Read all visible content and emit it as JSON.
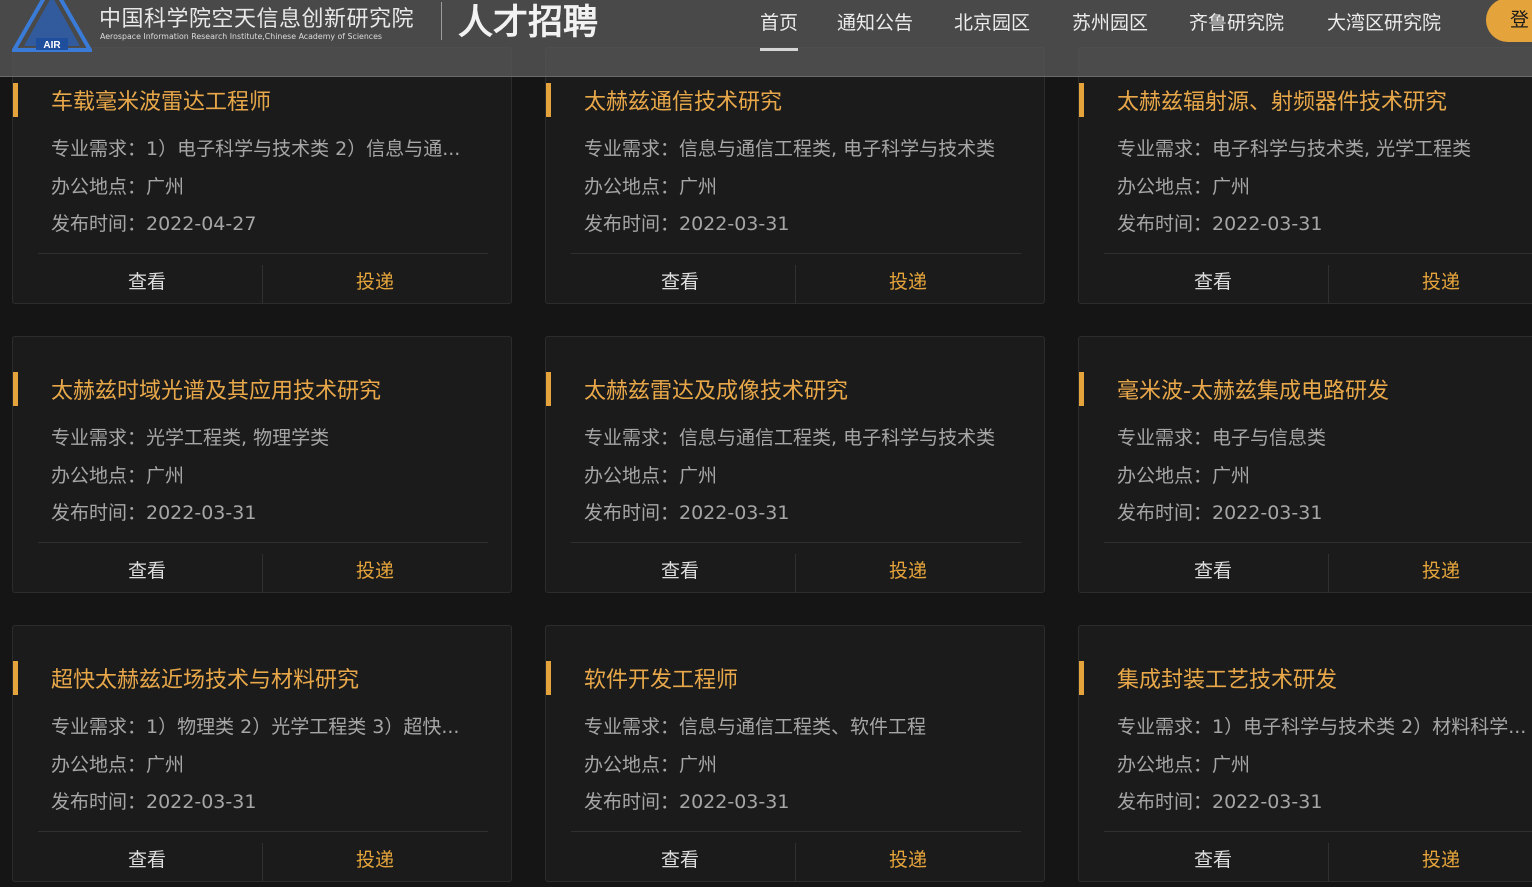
{
  "header": {
    "org_name_cn": "中国科学院空天信息创新研究院",
    "org_name_en": "Aerospace Information Research Institute,Chinese Academy of Sciences",
    "logo_text": "AIR",
    "recruit_title": "人才招聘",
    "nav": [
      "首页",
      "通知公告",
      "北京园区",
      "苏州园区",
      "齐鲁研究院",
      "大湾区研究院"
    ],
    "active_nav": "首页",
    "login_label": "登"
  },
  "colors": {
    "accent": "#e5a43b",
    "background": "#151515",
    "card": "#1b1b1b"
  },
  "card_buttons": {
    "view": "查看",
    "apply": "投递"
  },
  "jobs": [
    {
      "title": "车载毫米波雷达工程师",
      "major": "专业需求：1）电子科学与技术类 2）信息与通...",
      "location": "办公地点：广州",
      "date": "发布时间：2022-04-27"
    },
    {
      "title": "太赫兹通信技术研究",
      "major": "专业需求：信息与通信工程类, 电子科学与技术类",
      "location": "办公地点：广州",
      "date": "发布时间：2022-03-31"
    },
    {
      "title": "太赫兹辐射源、射频器件技术研究",
      "major": "专业需求：电子科学与技术类, 光学工程类",
      "location": "办公地点：广州",
      "date": "发布时间：2022-03-31"
    },
    {
      "title": "太赫兹时域光谱及其应用技术研究",
      "major": "专业需求：光学工程类, 物理学类",
      "location": "办公地点：广州",
      "date": "发布时间：2022-03-31"
    },
    {
      "title": "太赫兹雷达及成像技术研究",
      "major": "专业需求：信息与通信工程类, 电子科学与技术类",
      "location": "办公地点：广州",
      "date": "发布时间：2022-03-31"
    },
    {
      "title": "毫米波-太赫兹集成电路研发",
      "major": "专业需求：电子与信息类",
      "location": "办公地点：广州",
      "date": "发布时间：2022-03-31"
    },
    {
      "title": "超快太赫兹近场技术与材料研究",
      "major": "专业需求：1）物理类 2）光学工程类 3）超快...",
      "location": "办公地点：广州",
      "date": "发布时间：2022-03-31"
    },
    {
      "title": "软件开发工程师",
      "major": "专业需求：信息与通信工程类、软件工程",
      "location": "办公地点：广州",
      "date": "发布时间：2022-03-31"
    },
    {
      "title": "集成封装工艺技术研发",
      "major": "专业需求：1）电子科学与技术类 2）材料科学...",
      "location": "办公地点：广州",
      "date": "发布时间：2022-03-31"
    }
  ]
}
